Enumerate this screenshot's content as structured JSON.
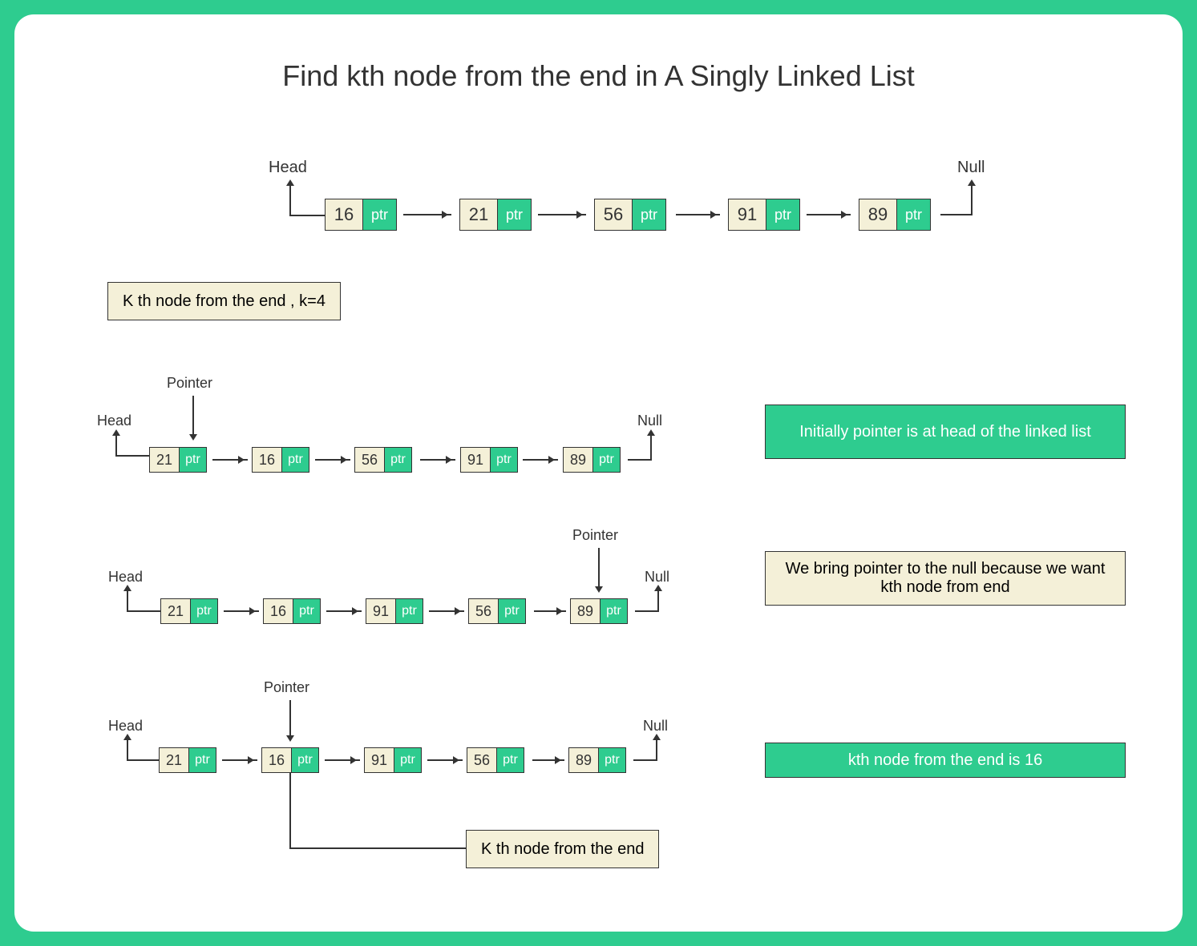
{
  "title": "Find kth node from the end in A Singly Linked List",
  "head_label": "Head",
  "null_label": "Null",
  "pointer_label": "Pointer",
  "ptr_text": "ptr",
  "lists": {
    "top": [
      "16",
      "21",
      "56",
      "91",
      "89"
    ],
    "step1": [
      "21",
      "16",
      "56",
      "91",
      "89"
    ],
    "step2": [
      "21",
      "16",
      "91",
      "56",
      "89"
    ],
    "step3": [
      "21",
      "16",
      "91",
      "56",
      "89"
    ]
  },
  "k_box": "K th node from the end , k=4",
  "step1_text": "Initially pointer is at head of the linked list",
  "step2_text": "We bring pointer to the null because we want kth node from end",
  "step3_text": "kth node from the end is 16",
  "result_box": "K th node from the end",
  "chart_data": {
    "type": "diagram",
    "structure": "singly-linked-list",
    "k": 4,
    "input_list": [
      16,
      21,
      56,
      91,
      89
    ],
    "steps": [
      {
        "list": [
          21,
          16,
          56,
          91,
          89
        ],
        "pointer_index": 0,
        "note": "Initially pointer is at head of the linked list"
      },
      {
        "list": [
          21,
          16,
          91,
          56,
          89
        ],
        "pointer_index": 4,
        "note": "We bring pointer to the null because we want kth node from end"
      },
      {
        "list": [
          21,
          16,
          91,
          56,
          89
        ],
        "pointer_index": 1,
        "note": "kth node from the end is 16"
      }
    ],
    "result_value": 16
  }
}
